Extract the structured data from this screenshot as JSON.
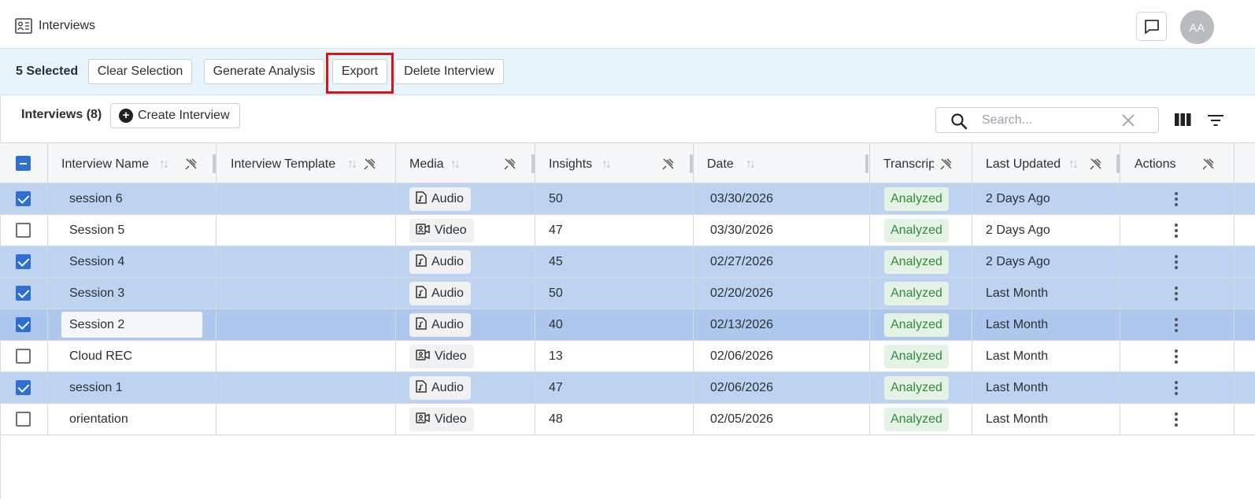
{
  "header": {
    "title": "Interviews",
    "avatar_initials": "AA"
  },
  "selection": {
    "count_label": "5 Selected",
    "buttons": [
      "Clear Selection",
      "Generate Analysis",
      "Export",
      "Delete Interview"
    ]
  },
  "toolbar": {
    "count_label": "Interviews (8)",
    "create_label": "Create Interview",
    "search_placeholder": "Search..."
  },
  "columns": [
    "Interview Name",
    "Interview Template",
    "Media",
    "Insights",
    "Date",
    "Transcript",
    "Last Updated",
    "Actions"
  ],
  "rows": [
    {
      "selected": true,
      "name": "session 6",
      "template": "",
      "media": "Audio",
      "insights": "50",
      "date": "03/30/2026",
      "status": "Analyzed",
      "updated": "2 Days Ago"
    },
    {
      "selected": false,
      "name": "Session 5",
      "template": "",
      "media": "Video",
      "insights": "47",
      "date": "03/30/2026",
      "status": "Analyzed",
      "updated": "2 Days Ago"
    },
    {
      "selected": true,
      "name": "Session 4",
      "template": "",
      "media": "Audio",
      "insights": "45",
      "date": "02/27/2026",
      "status": "Analyzed",
      "updated": "2 Days Ago"
    },
    {
      "selected": true,
      "name": "Session 3",
      "template": "",
      "media": "Audio",
      "insights": "50",
      "date": "02/20/2026",
      "status": "Analyzed",
      "updated": "Last Month"
    },
    {
      "selected": true,
      "name": "Session 2",
      "template": "",
      "media": "Audio",
      "insights": "40",
      "date": "02/13/2026",
      "status": "Analyzed",
      "updated": "Last Month"
    },
    {
      "selected": false,
      "name": "Cloud REC",
      "template": "",
      "media": "Video",
      "insights": "13",
      "date": "02/06/2026",
      "status": "Analyzed",
      "updated": "Last Month"
    },
    {
      "selected": true,
      "name": "session 1",
      "template": "",
      "media": "Audio",
      "insights": "47",
      "date": "02/06/2026",
      "status": "Analyzed",
      "updated": "Last Month"
    },
    {
      "selected": false,
      "name": "orientation",
      "template": "",
      "media": "Video",
      "insights": "48",
      "date": "02/05/2026",
      "status": "Analyzed",
      "updated": "Last Month"
    }
  ],
  "icons": {
    "page": "interviews-contact-icon",
    "chat": "chat-bubble-icon",
    "search": "search-icon",
    "clear": "close-icon",
    "columns": "columns-icon",
    "filter": "filter-icon",
    "sort": "sort-icon",
    "pin": "pin-off-icon",
    "audio": "audio-file-icon",
    "video": "video-icon",
    "actions": "more-vertical-icon"
  },
  "colors": {
    "selection_bar": "#e7f4fb",
    "selected_row": "#bdd3ef",
    "checkbox": "#2f6fd1",
    "analyzed_text": "#2e8b3a",
    "analyzed_bg": "#e5f3e6",
    "highlight": "#d6151a"
  }
}
